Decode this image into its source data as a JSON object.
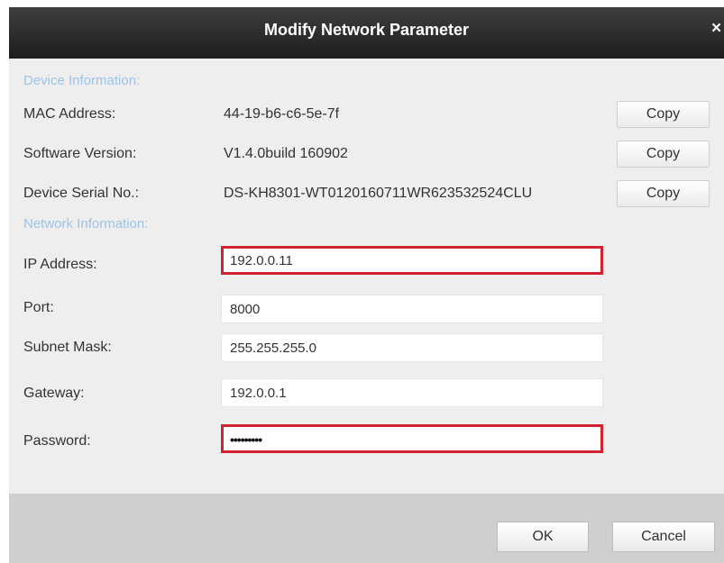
{
  "dialog": {
    "title": "Modify Network Parameter",
    "close_symbol": "×"
  },
  "device_info": {
    "heading": "Device Information:",
    "rows": [
      {
        "label": "MAC Address:",
        "value": "44-19-b6-c6-5e-7f",
        "button": "Copy"
      },
      {
        "label": "Software Version:",
        "value": "V1.4.0build 160902",
        "button": "Copy"
      },
      {
        "label": "Device Serial No.:",
        "value": "DS-KH8301-WT0120160711WR623532524CLU",
        "button": "Copy"
      }
    ]
  },
  "network_info": {
    "heading": "Network Information:",
    "ip": {
      "label": "IP Address:",
      "value": "192.0.0.11"
    },
    "port": {
      "label": "Port:",
      "value": "8000"
    },
    "subnet": {
      "label": "Subnet Mask:",
      "value": "255.255.255.0"
    },
    "gateway": {
      "label": "Gateway:",
      "value": "192.0.0.1"
    },
    "password": {
      "label": "Password:",
      "value": "•••••••••"
    }
  },
  "footer": {
    "ok_label": "OK",
    "cancel_label": "Cancel"
  },
  "colors": {
    "highlight_border": "#d1222f",
    "section_heading": "#9cc3e6",
    "titlebar": "#2a2a2a"
  }
}
